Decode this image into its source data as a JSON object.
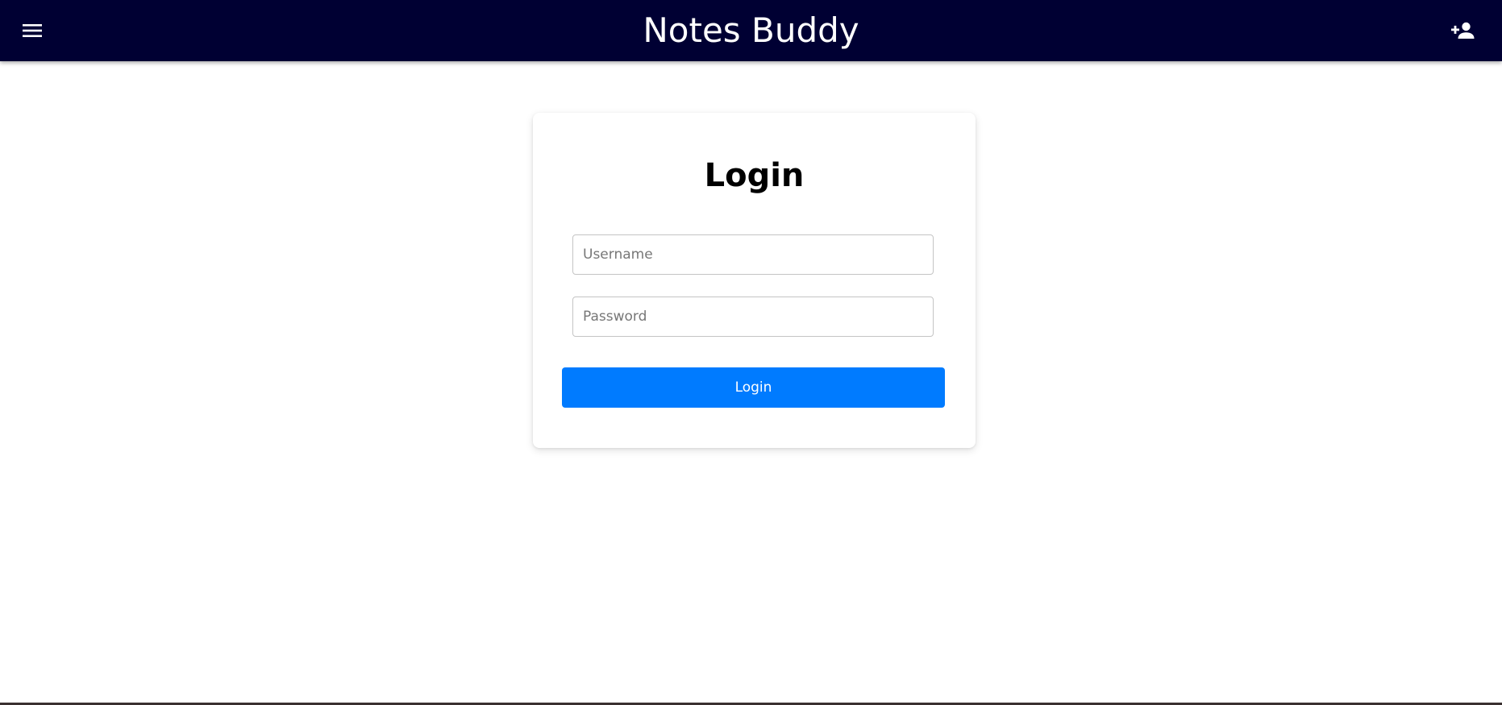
{
  "navbar": {
    "brand": "Notes Buddy",
    "menu_icon": "menu-icon",
    "add_user_icon": "person-add-icon",
    "background_color": "#000033"
  },
  "login_form": {
    "title": "Login",
    "username": {
      "placeholder": "Username",
      "value": ""
    },
    "password": {
      "placeholder": "Password",
      "value": ""
    },
    "submit_label": "Login",
    "button_color": "#007bff"
  }
}
